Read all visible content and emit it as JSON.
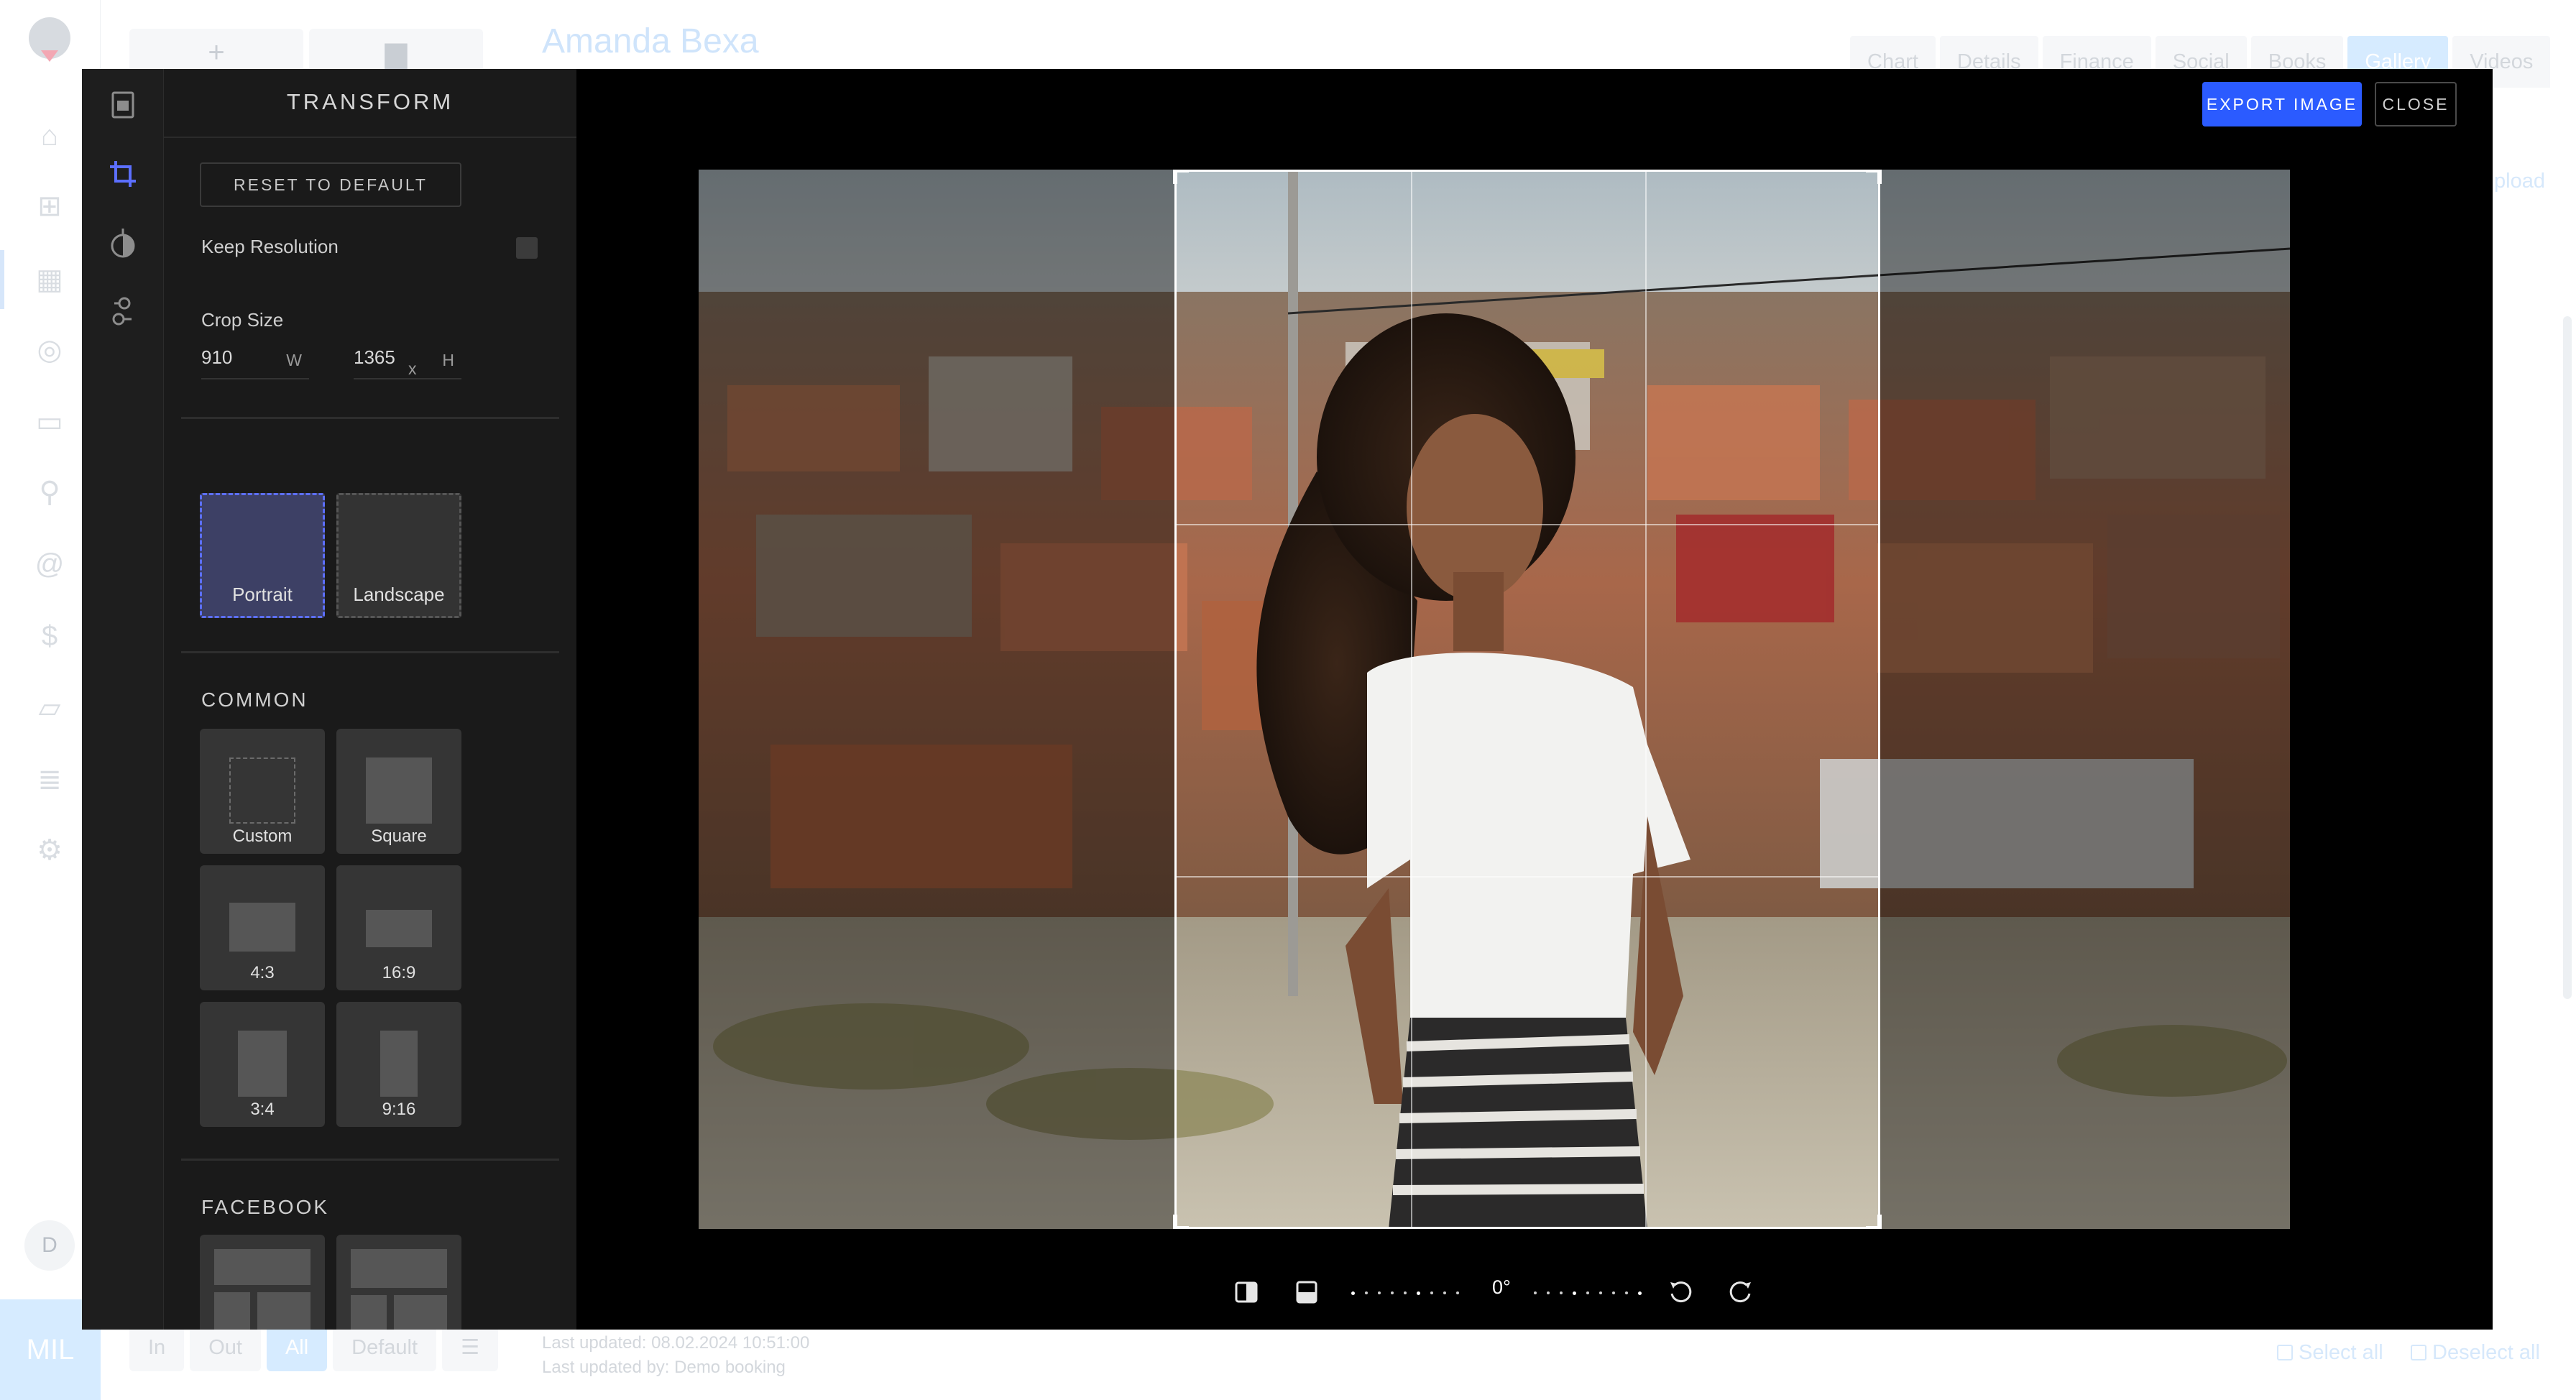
{
  "background": {
    "title": "Amanda Bexa",
    "top_buttons": [
      "+",
      "▆"
    ],
    "tabs": [
      {
        "label": "Chart",
        "active": false
      },
      {
        "label": "Details",
        "active": false
      },
      {
        "label": "Finance",
        "active": false
      },
      {
        "label": "Social",
        "active": false
      },
      {
        "label": "Books",
        "active": false
      },
      {
        "label": "Gallery",
        "active": true
      },
      {
        "label": "Videos",
        "active": false
      }
    ],
    "upload_label": "pload",
    "avatar_letter": "D",
    "brand_text": "MIL",
    "filters": [
      {
        "label": "In",
        "active": false
      },
      {
        "label": "Out",
        "active": false
      },
      {
        "label": "All",
        "active": true
      },
      {
        "label": "Default",
        "active": false
      },
      {
        "label": "☰",
        "active": false
      }
    ],
    "last_updated": "Last updated: 08.02.2024 10:51:00",
    "last_updated_by": "Last updated by: Demo booking",
    "select_all": "Select all",
    "deselect_all": "Deselect all"
  },
  "editor": {
    "panel_title": "TRANSFORM",
    "reset_label": "RESET TO DEFAULT",
    "keep_resolution_label": "Keep Resolution",
    "keep_resolution_checked": false,
    "crop_size_label": "Crop Size",
    "width_value": "910",
    "width_unit": "W",
    "times": "x",
    "height_value": "1365",
    "height_unit": "H",
    "orientations": [
      {
        "label": "Portrait",
        "active": true
      },
      {
        "label": "Landscape",
        "active": false
      }
    ],
    "common_title": "COMMON",
    "presets": [
      {
        "label": "Custom"
      },
      {
        "label": "Square"
      },
      {
        "label": "4:3"
      },
      {
        "label": "16:9"
      },
      {
        "label": "3:4"
      },
      {
        "label": "9:16"
      }
    ],
    "facebook_title": "FACEBOOK",
    "export_label": "EXPORT IMAGE",
    "close_label": "CLOSE",
    "rotation_label": "0°",
    "accent_color": "#2b5bff"
  }
}
